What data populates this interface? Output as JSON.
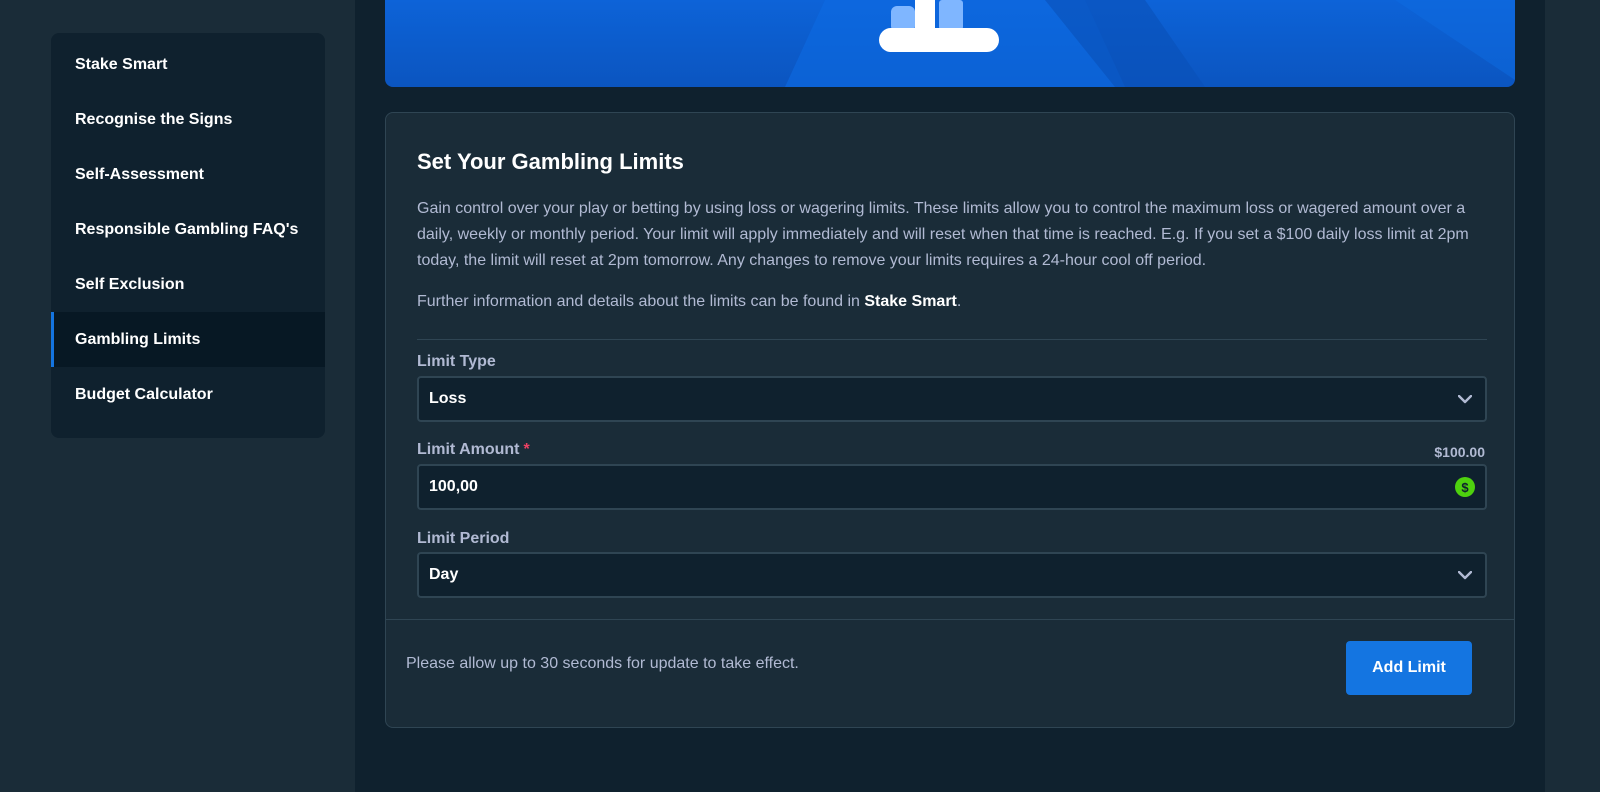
{
  "sidebar": {
    "items": [
      {
        "label": "Stake Smart"
      },
      {
        "label": "Recognise the Signs"
      },
      {
        "label": "Self-Assessment"
      },
      {
        "label": "Responsible Gambling FAQ's"
      },
      {
        "label": "Self Exclusion"
      },
      {
        "label": "Gambling Limits",
        "active": true
      },
      {
        "label": "Budget Calculator"
      }
    ]
  },
  "card": {
    "title": "Set Your Gambling Limits",
    "description": "Gain control over your play or betting by using loss or wagering limits. These limits allow you to control the maximum loss or wagered amount over a daily, weekly or monthly period. Your limit will apply immediately and will reset when that time is reached. E.g. If you set a $100 daily loss limit at 2pm today, the limit will reset at 2pm tomorrow. Any changes to remove your limits requires a 24-hour cool off period.",
    "further_text": "Further information and details about the limits can be found in",
    "further_link": "Stake Smart",
    "further_end": "."
  },
  "form": {
    "limit_type": {
      "label": "Limit Type",
      "value": "Loss"
    },
    "limit_amount": {
      "label": "Limit Amount",
      "required_mark": "*",
      "value": "100,00",
      "converted": "$100.00",
      "currency_symbol": "$"
    },
    "limit_period": {
      "label": "Limit Period",
      "value": "Day"
    }
  },
  "footer": {
    "note": "Please allow up to 30 seconds for update to take effect.",
    "button_label": "Add Limit"
  },
  "colors": {
    "accent": "#1475e1",
    "currency_green": "#4ed10e",
    "required_red": "#ed4163"
  }
}
